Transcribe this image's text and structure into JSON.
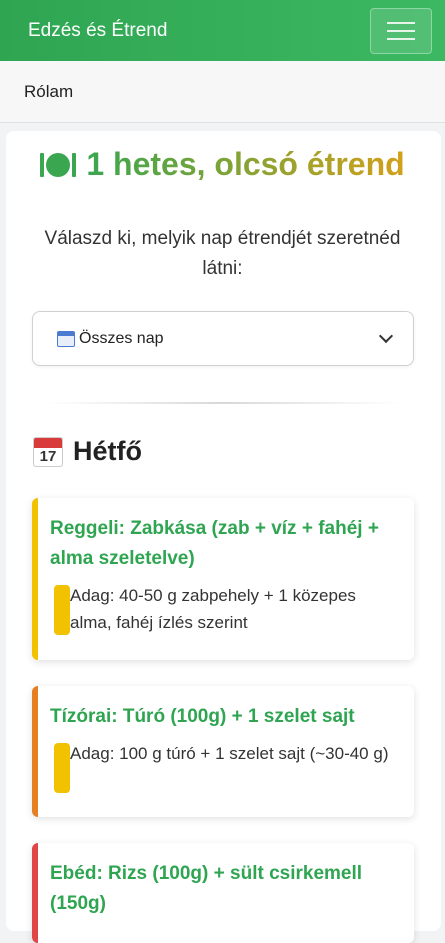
{
  "navbar": {
    "brand": "Edzés és Étrend"
  },
  "subnav": {
    "link": "Rólam"
  },
  "page": {
    "title": "1 hetes, olcsó étrend",
    "subtitle": "Válaszd ki, melyik nap étrendjét szeretnéd látni:"
  },
  "day_select": {
    "value": "Összes nap"
  },
  "day": {
    "name": "Hétfő",
    "calendar_number": "17",
    "meals": [
      {
        "title": "Reggeli: Zabkása (zab + víz + fahéj + alma szeletelve)",
        "detail": "Adag: 40-50 g zabpehely + 1 közepes alma, fahéj ízlés szerint",
        "color": "#f2c200"
      },
      {
        "title": "Tízórai: Túró (100g) + 1 szelet sajt",
        "detail": "Adag: 100 g túró + 1 szelet sajt (~30-40 g)",
        "color": "#e67e22"
      },
      {
        "title": "Ebéd: Rizs (100g) + sült csirkemell (150g)",
        "detail": "",
        "color": "#e04646"
      }
    ]
  }
}
